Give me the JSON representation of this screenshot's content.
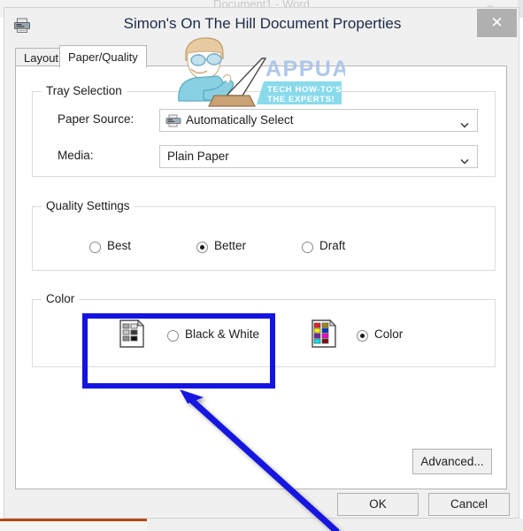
{
  "background_app": {
    "title": "Document1 - Word"
  },
  "dialog": {
    "title": "Simon's On The Hill Document Properties",
    "titlebar_icon": "printer-icon",
    "close_label": "✕",
    "tabs": [
      {
        "label": "Layout",
        "active": false
      },
      {
        "label": "Paper/Quality",
        "active": true
      }
    ],
    "groups": {
      "tray_selection": {
        "title": "Tray Selection",
        "fields": [
          {
            "label": "Paper Source:",
            "value": "Automatically Select",
            "icon": "printer-icon",
            "control": "dropdown"
          },
          {
            "label": "Media:",
            "value": "Plain Paper",
            "icon": null,
            "control": "dropdown"
          }
        ]
      },
      "quality_settings": {
        "title": "Quality Settings",
        "options": [
          {
            "label": "Best",
            "checked": false
          },
          {
            "label": "Better",
            "checked": true
          },
          {
            "label": "Draft",
            "checked": false
          }
        ]
      },
      "color": {
        "title": "Color",
        "options": [
          {
            "label": "Black & White",
            "checked": false,
            "icon": "grayscale-swatch-icon"
          },
          {
            "label": "Color",
            "checked": true,
            "icon": "color-swatch-icon"
          }
        ]
      }
    },
    "buttons": {
      "advanced": "Advanced...",
      "ok": "OK",
      "cancel": "Cancel"
    }
  },
  "watermark": {
    "brand": "APPUALS",
    "tagline_line1": "TECH HOW-TO'S FROM",
    "tagline_line2": "THE EXPERTS!"
  },
  "annotations": {
    "highlight_target": "Black & White",
    "highlight_color": "#1414e0",
    "arrow_color": "#1414e0"
  }
}
